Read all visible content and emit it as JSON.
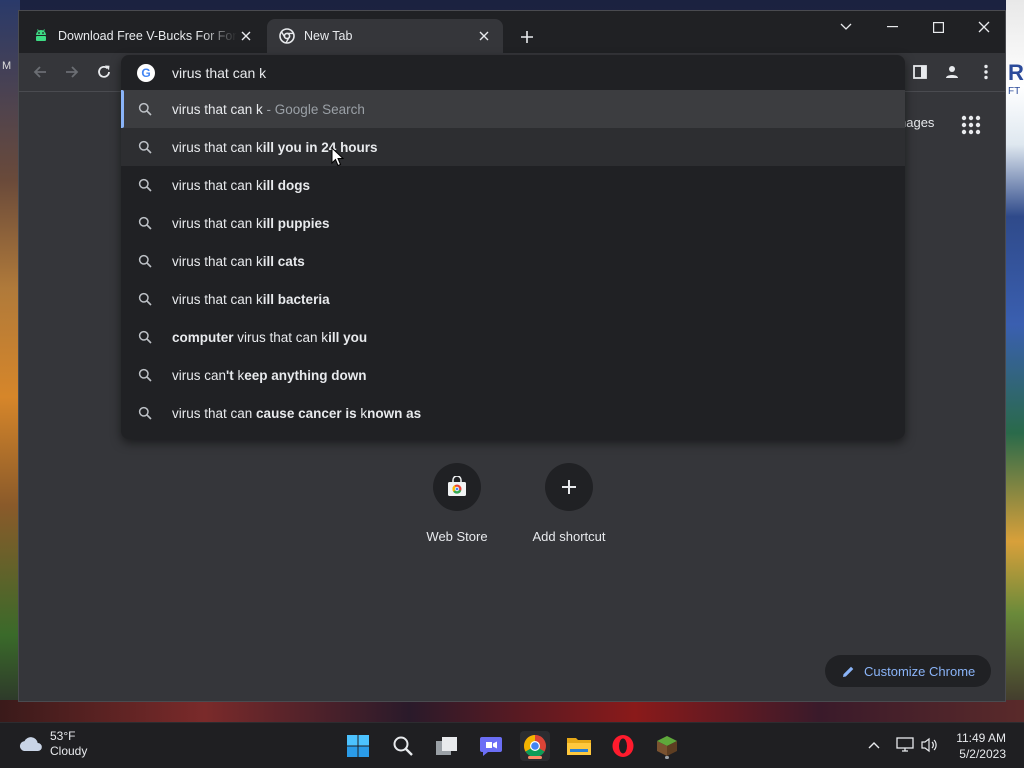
{
  "browser": {
    "tabs": [
      {
        "title": "Download Free V-Bucks For Fortnite",
        "favicon": "android-icon",
        "active": false
      },
      {
        "title": "New Tab",
        "favicon": "chrome-icon",
        "active": true
      }
    ]
  },
  "omnibox": {
    "query": "virus that can k",
    "suggestions": [
      {
        "parts": [
          {
            "t": "virus that can k",
            "b": false
          },
          {
            "t": " - Google Search",
            "b": false,
            "dim": true
          }
        ],
        "selected": true
      },
      {
        "parts": [
          {
            "t": "virus that can k",
            "b": false
          },
          {
            "t": "ill you in 24 hours",
            "b": true
          }
        ],
        "hover": true
      },
      {
        "parts": [
          {
            "t": "virus that can k",
            "b": false
          },
          {
            "t": "ill dogs",
            "b": true
          }
        ]
      },
      {
        "parts": [
          {
            "t": "virus that can k",
            "b": false
          },
          {
            "t": "ill puppies",
            "b": true
          }
        ]
      },
      {
        "parts": [
          {
            "t": "virus that can k",
            "b": false
          },
          {
            "t": "ill cats",
            "b": true
          }
        ]
      },
      {
        "parts": [
          {
            "t": "virus that can k",
            "b": false
          },
          {
            "t": "ill bacteria",
            "b": true
          }
        ]
      },
      {
        "parts": [
          {
            "t": "computer",
            "b": true
          },
          {
            "t": " virus that can k",
            "b": false
          },
          {
            "t": "ill you",
            "b": true
          }
        ]
      },
      {
        "parts": [
          {
            "t": "virus can",
            "b": false
          },
          {
            "t": "'t ",
            "b": true
          },
          {
            "t": "k",
            "b": false
          },
          {
            "t": "eep anything down",
            "b": true
          }
        ]
      },
      {
        "parts": [
          {
            "t": "virus that can ",
            "b": false
          },
          {
            "t": "cause can",
            "b": true
          },
          {
            "t": "cer is ",
            "b": true
          },
          {
            "t": "k",
            "b": false
          },
          {
            "t": "nown as",
            "b": true
          }
        ]
      }
    ]
  },
  "ntp": {
    "images_label": "nages",
    "shortcuts": [
      {
        "label": "Web Store",
        "icon": "web-store-icon"
      },
      {
        "label": "Add shortcut",
        "icon": "plus-icon"
      }
    ],
    "customize_label": "Customize Chrome"
  },
  "background": {
    "right_letter": "R",
    "right_small": "FT",
    "left_letter": "M"
  },
  "taskbar": {
    "weather_temp": "53°F",
    "weather_desc": "Cloudy",
    "apps": [
      "windows-start-icon",
      "search-icon",
      "task-view-icon",
      "teams-chat-icon",
      "chrome-icon",
      "file-explorer-icon",
      "opera-icon",
      "minecraft-icon"
    ],
    "time": "11:49 AM",
    "date": "5/2/2023"
  },
  "colors": {
    "accent": "#8ab4f8",
    "tabstrip": "#202124",
    "toolbar": "#35363a"
  }
}
